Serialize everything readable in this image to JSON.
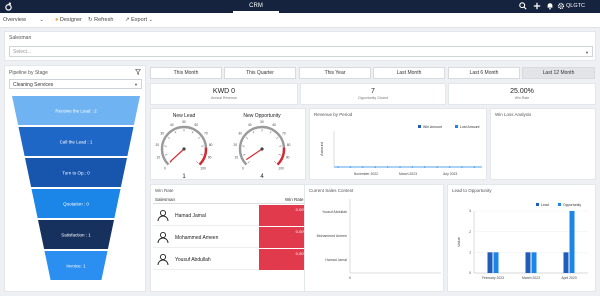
{
  "topbar": {
    "app_tab": "CRM",
    "user": "QLGTC",
    "icons": [
      "search-icon",
      "plus-icon",
      "bell-icon",
      "gear-icon"
    ]
  },
  "toolbar": {
    "view": "Overview",
    "designer": "Designer",
    "refresh": "Refresh",
    "export": "Export"
  },
  "salesman": {
    "label": "Salesman",
    "placeholder": "Select..."
  },
  "pipeline": {
    "title": "Pipeline by Stage",
    "selected": "Cleaning Services",
    "stages": [
      {
        "label": "Receive the Lead : 2",
        "value": 2,
        "color": "#6fb3f2"
      },
      {
        "label": "Call the Lead : 1",
        "value": 1,
        "color": "#1f67c6"
      },
      {
        "label": "Turn to Op.: 0",
        "value": 0,
        "color": "#1856ad"
      },
      {
        "label": "Quotation : 0",
        "value": 0,
        "color": "#1b86e8"
      },
      {
        "label": "Satisfaction : 1",
        "value": 1,
        "color": "#17315f"
      },
      {
        "label": "Invoice: 1",
        "value": 1,
        "color": "#2a8ff0"
      }
    ]
  },
  "period_tabs": [
    {
      "label": "This Month",
      "active": false
    },
    {
      "label": "This Quarter",
      "active": false
    },
    {
      "label": "This Year",
      "active": false
    },
    {
      "label": "Last Month",
      "active": false
    },
    {
      "label": "Last 6 Month",
      "active": false
    },
    {
      "label": "Last 12 Month",
      "active": true
    }
  ],
  "kpis": [
    {
      "value": "KWD 0",
      "label": "Annual Revenue"
    },
    {
      "value": "7",
      "label": "Opportunity Closed"
    },
    {
      "value": "25.00%",
      "label": "Win Rate"
    }
  ],
  "gauges": [
    {
      "title": "New Lead",
      "value": 1,
      "min": 0,
      "max": 100,
      "ticks": [
        "0",
        "10",
        "20",
        "30",
        "40",
        "50",
        "60",
        "70",
        "80",
        "90",
        "100"
      ],
      "display": "1"
    },
    {
      "title": "New Opportunity",
      "value": 4,
      "min": 0,
      "max": 100,
      "ticks": [
        "0",
        "10",
        "20",
        "30",
        "40",
        "50",
        "60",
        "70",
        "80",
        "90",
        "100"
      ],
      "display": "4"
    }
  ],
  "revenue_by_period": {
    "title": "Revenue by Period",
    "legend": [
      "Win Amount",
      "Lost Amount"
    ],
    "ylabel": "Amount",
    "x_labels": [
      "November 2022",
      "March 2023",
      "July 2023"
    ]
  },
  "win_loss": {
    "title": "Win Loss Analysis"
  },
  "win_rate": {
    "title": "Win Rate",
    "columns": [
      "Salesman",
      "Win Rate"
    ],
    "rows": [
      {
        "name": "Hamad Jamal",
        "rate": "0.00%"
      },
      {
        "name": "Mohammed Ameen",
        "rate": "0.00%"
      },
      {
        "name": "Yousuf Abdullah",
        "rate": "0.00%"
      }
    ]
  },
  "sales_contest": {
    "title": "Current Sales Contest",
    "names": [
      "Yousuf Abdullah",
      "Mohammed Ameen",
      "Hamad Jamal"
    ],
    "ticks": [
      "0",
      "1"
    ]
  },
  "chart_data": {
    "type": "bar",
    "title": "Lead to Opportunity",
    "categories": [
      "February 2023",
      "March 2023",
      "April 2023"
    ],
    "series": [
      {
        "name": "Lead",
        "values": [
          1,
          1,
          1
        ],
        "color": "#1f5db8"
      },
      {
        "name": "Opportunity",
        "values": [
          1,
          1,
          3
        ],
        "color": "#1b86e8"
      }
    ],
    "ylabel": "Value",
    "ylim": [
      0,
      3
    ],
    "yticks": [
      "0",
      "1",
      "2",
      "3"
    ],
    "legend_position": "top-right"
  },
  "colors": {
    "topbar": "#16233e",
    "danger": "#e23a4d",
    "accent": "#1b86e8"
  }
}
